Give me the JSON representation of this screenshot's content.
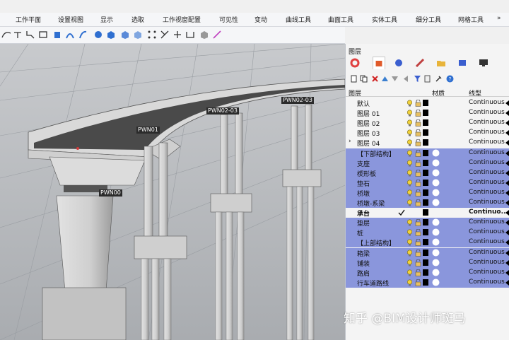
{
  "menu_tabs": [
    "工作平面",
    "设置视图",
    "显示",
    "选取",
    "工作视窗配置",
    "可见性",
    "变动",
    "曲线工具",
    "曲面工具",
    "实体工具",
    "细分工具",
    "网格工具",
    "»"
  ],
  "pier_labels": [
    "PWN01",
    "PWN02-03",
    "PWN02-03",
    "PWN00"
  ],
  "panel": {
    "title": "图层",
    "columns": {
      "layer": "图层",
      "material": "材质",
      "linetype": "线型"
    }
  },
  "layers": [
    {
      "name": "默认",
      "linetype": "Continuous",
      "selected": false,
      "bold": false,
      "current": false,
      "expander": ""
    },
    {
      "name": "图层 01",
      "linetype": "Continuous",
      "selected": false,
      "bold": false,
      "current": false,
      "expander": ""
    },
    {
      "name": "图层 02",
      "linetype": "Continuous",
      "selected": false,
      "bold": false,
      "current": false,
      "expander": ""
    },
    {
      "name": "图层 03",
      "linetype": "Continuous",
      "selected": false,
      "bold": false,
      "current": false,
      "expander": ""
    },
    {
      "name": "图层 04",
      "linetype": "Continuous",
      "selected": false,
      "bold": false,
      "current": false,
      "expander": "›"
    },
    {
      "name": "【下部结构】",
      "linetype": "Continuous",
      "selected": true,
      "bold": false,
      "current": false,
      "expander": ""
    },
    {
      "name": "支座",
      "linetype": "Continuous",
      "selected": true,
      "bold": false,
      "current": false,
      "expander": ""
    },
    {
      "name": "楔形板",
      "linetype": "Continuous",
      "selected": true,
      "bold": false,
      "current": false,
      "expander": ""
    },
    {
      "name": "垫石",
      "linetype": "Continuous",
      "selected": true,
      "bold": false,
      "current": false,
      "expander": ""
    },
    {
      "name": "桥墩",
      "linetype": "Continuous",
      "selected": true,
      "bold": false,
      "current": false,
      "expander": ""
    },
    {
      "name": "桥墩-系梁",
      "linetype": "Continuous",
      "selected": true,
      "bold": false,
      "current": false,
      "expander": ""
    },
    {
      "name": "承台",
      "linetype": "Continuo...",
      "selected": false,
      "bold": true,
      "current": true,
      "expander": ""
    },
    {
      "name": "垫层",
      "linetype": "Continuous",
      "selected": true,
      "bold": false,
      "current": false,
      "expander": ""
    },
    {
      "name": "桩",
      "linetype": "Continuous",
      "selected": true,
      "bold": false,
      "current": false,
      "expander": ""
    },
    {
      "name": "【上部结构】",
      "linetype": "Continuous",
      "selected": true,
      "bold": false,
      "current": false,
      "expander": ""
    },
    {
      "name": "箱梁",
      "linetype": "Continuous",
      "selected": true,
      "bold": false,
      "current": false,
      "expander": ""
    },
    {
      "name": "铺装",
      "linetype": "Continuous",
      "selected": true,
      "bold": false,
      "current": false,
      "expander": ""
    },
    {
      "name": "路肩",
      "linetype": "Continuous",
      "selected": true,
      "bold": false,
      "current": false,
      "expander": ""
    },
    {
      "name": "行车道路线",
      "linetype": "Continuous",
      "selected": true,
      "bold": false,
      "current": false,
      "expander": ""
    }
  ],
  "watermark": "知乎 @BIM设计师斑马",
  "colors": {
    "selection": "#8a96dc",
    "viewport_bg": "#b9bcc0"
  }
}
